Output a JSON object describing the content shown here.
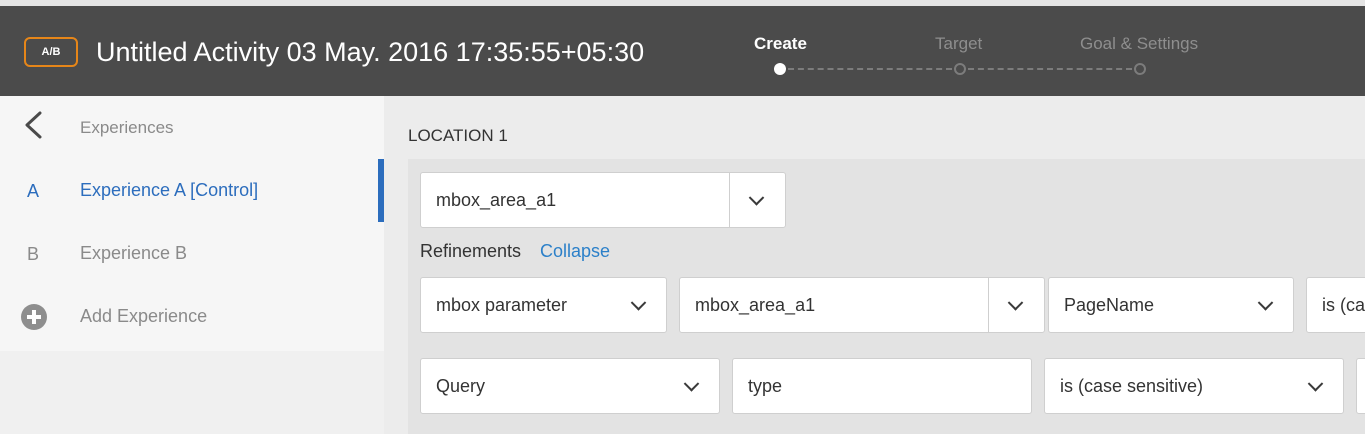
{
  "header": {
    "badge": "A/B",
    "title": "Untitled Activity 03 May. 2016 17:35:55+05:30",
    "steps": [
      {
        "label": "Create",
        "active": true
      },
      {
        "label": "Target",
        "active": false
      },
      {
        "label": "Goal & Settings",
        "active": false
      }
    ]
  },
  "sidebar": {
    "heading": "Experiences",
    "items": [
      {
        "letter": "A",
        "label": "Experience A [Control]",
        "active": true
      },
      {
        "letter": "B",
        "label": "Experience B",
        "active": false
      }
    ],
    "add_label": "Add Experience"
  },
  "location": {
    "label": "LOCATION 1",
    "mbox_value": "mbox_area_a1",
    "refinements_label": "Refinements",
    "collapse_label": "Collapse",
    "rows": [
      {
        "type": "mbox parameter",
        "mbox": "mbox_area_a1",
        "param": "PageName",
        "operator": "is (cas"
      },
      {
        "type": "Query",
        "value": "type",
        "operator": "is (case sensitive)"
      }
    ]
  },
  "colors": {
    "header_bg": "#4b4b4b",
    "accent_orange": "#e68619",
    "accent_blue": "#2c6dbd",
    "link_blue": "#2c80c9"
  }
}
